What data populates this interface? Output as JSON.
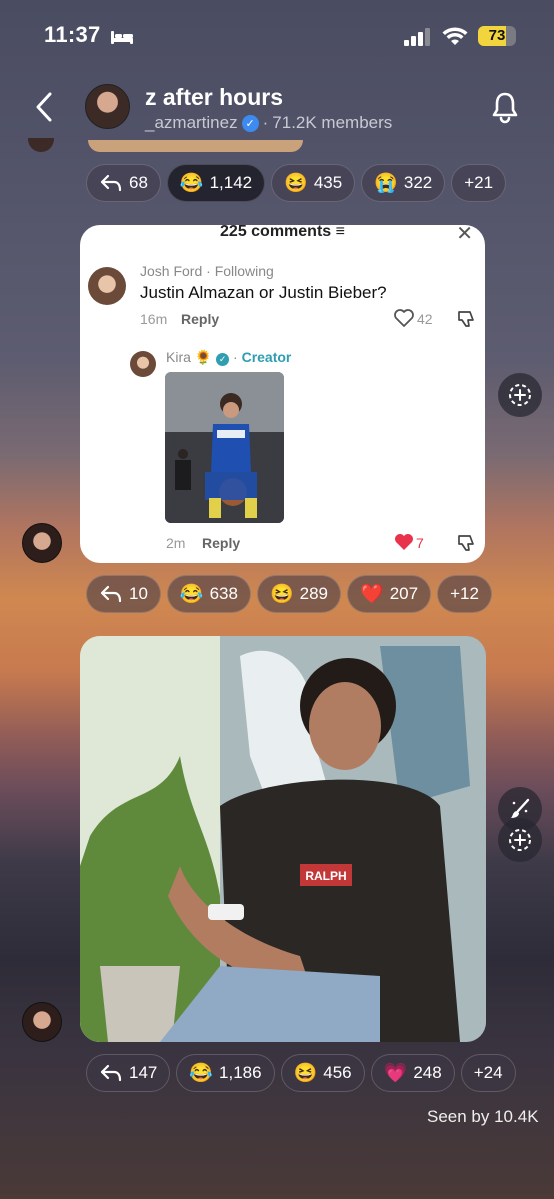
{
  "status_bar": {
    "time": "11:37",
    "battery": "73",
    "battery_level": 0.73
  },
  "header": {
    "title": "z after hours",
    "handle": "_azmartinez",
    "members": "71.2K members",
    "separator": "·"
  },
  "reactions_top": [
    {
      "icon": "reply-icon",
      "count": "68"
    },
    {
      "emoji": "😂",
      "count": "1,142",
      "active": true
    },
    {
      "emoji": "😆",
      "count": "435"
    },
    {
      "emoji": "😭",
      "count": "322"
    },
    {
      "count": "+21"
    }
  ],
  "comments": {
    "count_label": "225 comments",
    "filter_glyph": "≡",
    "close_glyph": "✕",
    "top": {
      "author": "Josh Ford",
      "relation": "Following",
      "text": "Justin Almazan or Justin Bieber?",
      "time": "16m",
      "reply_label": "Reply",
      "likes": "42"
    },
    "reply": {
      "author": "Kira",
      "flower": "🌻",
      "badge": "Creator",
      "time": "2m",
      "reply_label": "Reply",
      "likes": "7"
    }
  },
  "reactions_middle": [
    {
      "icon": "reply-icon",
      "count": "10"
    },
    {
      "emoji": "😂",
      "count": "638"
    },
    {
      "emoji": "😆",
      "count": "289"
    },
    {
      "emoji": "❤️",
      "count": "207"
    },
    {
      "count": "+12"
    }
  ],
  "photo": {
    "shirt_text": "RALPH"
  },
  "reactions_bottom": [
    {
      "icon": "reply-icon",
      "count": "147"
    },
    {
      "emoji": "😂",
      "count": "1,186"
    },
    {
      "emoji": "😆",
      "count": "456"
    },
    {
      "emoji": "💗",
      "count": "248"
    },
    {
      "count": "+24"
    }
  ],
  "seen_by": "Seen by 10.4K",
  "colors": {
    "accent_blue": "#3d8bf0",
    "creator_teal": "#2e9eb0",
    "battery_yellow": "#f2d43c",
    "heart_red": "#e8344a"
  }
}
